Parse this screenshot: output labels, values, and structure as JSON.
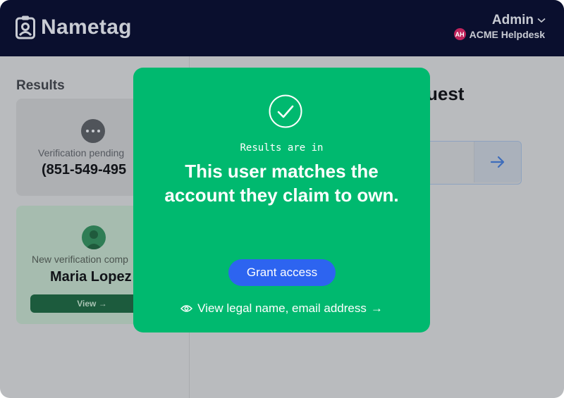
{
  "header": {
    "brand": "Nametag",
    "user_menu": "Admin",
    "org_name": "ACME Helpdesk",
    "org_initials": "AH"
  },
  "results": {
    "heading": "Results",
    "pending": {
      "label": "Verification pending",
      "phone": "(851-549-495"
    },
    "completed": {
      "label": "New verification comp",
      "name": "Maria Lopez",
      "view_label": "View →"
    }
  },
  "request": {
    "title": "uest"
  },
  "modal": {
    "eyebrow": "Results are in",
    "title": "This user matches the account they claim to own.",
    "grant_label": "Grant access",
    "link_label": "View legal name, email address",
    "link_arrow": "→"
  },
  "colors": {
    "header_bg": "#0a0f2e",
    "modal_bg": "#00b96f",
    "primary_button": "#2d64f0",
    "org_badge": "#c0245c"
  }
}
